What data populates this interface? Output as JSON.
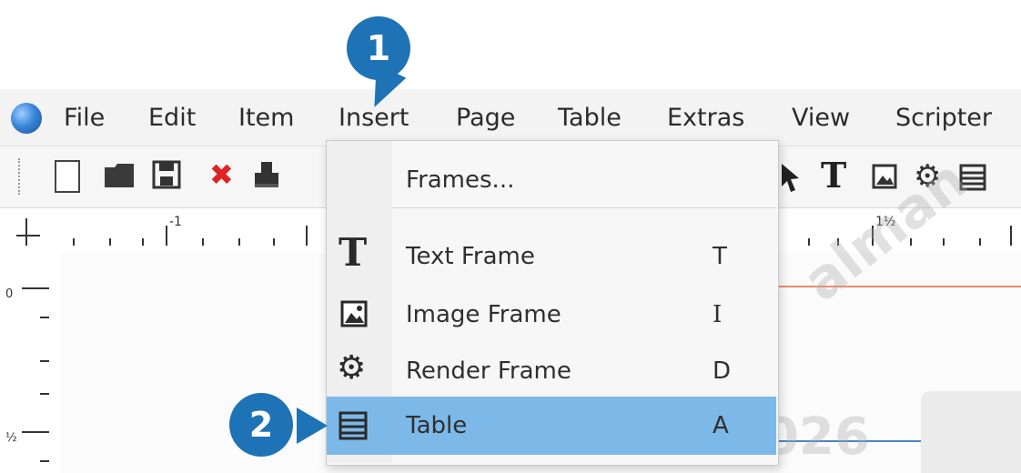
{
  "menubar": {
    "items": [
      "File",
      "Edit",
      "Item",
      "Insert",
      "Page",
      "Table",
      "Extras",
      "View",
      "Scripter"
    ]
  },
  "insert_menu": {
    "items": [
      {
        "label": "Frames...",
        "shortcut": "",
        "icon": "none"
      },
      {
        "label": "Text Frame",
        "shortcut": "T",
        "icon": "text-frame-icon"
      },
      {
        "label": "Image Frame",
        "shortcut": "I",
        "icon": "image-frame-icon"
      },
      {
        "label": "Render Frame",
        "shortcut": "D",
        "icon": "render-frame-icon"
      },
      {
        "label": "Table",
        "shortcut": "A",
        "icon": "table-icon",
        "highlighted": true
      }
    ]
  },
  "ruler": {
    "h_labels": [
      "-1",
      "1½"
    ],
    "v_labels": [
      "0",
      "½"
    ]
  },
  "callouts": {
    "step1": "1",
    "step2": "2"
  },
  "watermark": {
    "text1": "alman",
    "text2": "2026"
  },
  "colors": {
    "highlight": "#7db9e8",
    "badge": "#1e73b7",
    "accent_red": "#f08a6e"
  }
}
